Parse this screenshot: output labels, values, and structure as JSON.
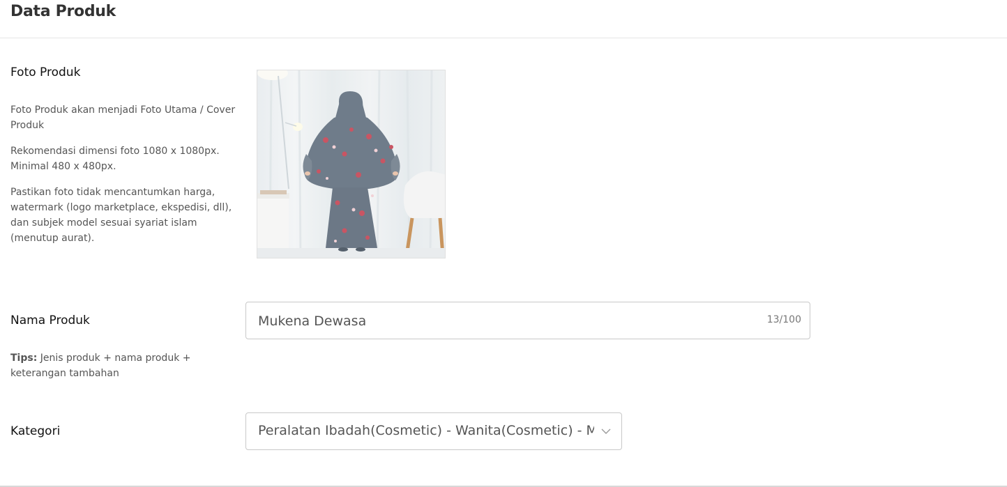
{
  "header": {
    "title": "Data Produk"
  },
  "photo_section": {
    "label": "Foto Produk",
    "help": [
      "Foto Produk akan menjadi Foto Utama / Cover Produk",
      "Rekomendasi dimensi foto 1080 x 1080px. Minimal 480 x 480px.",
      "Pastikan foto tidak mencantumkan harga, watermark (logo marketplace, ekspedisi, dll), dan subjek model sesuai syariat islam (menutup aurat)."
    ]
  },
  "name_section": {
    "label": "Nama Produk",
    "tips_prefix": "Tips:",
    "tips_text": "Jenis produk + nama produk + keterangan tambahan",
    "value": "Mukena Dewasa",
    "char_count": "13/100"
  },
  "category_section": {
    "label": "Kategori",
    "value": "Peralatan Ibadah(Cosmetic) - Wanita(Cosmetic) - Mukena"
  },
  "colors": {
    "dress": "#6f7c8a",
    "floral": "#c95563",
    "chair": "#f4f4f4",
    "wood": "#c9955e"
  }
}
